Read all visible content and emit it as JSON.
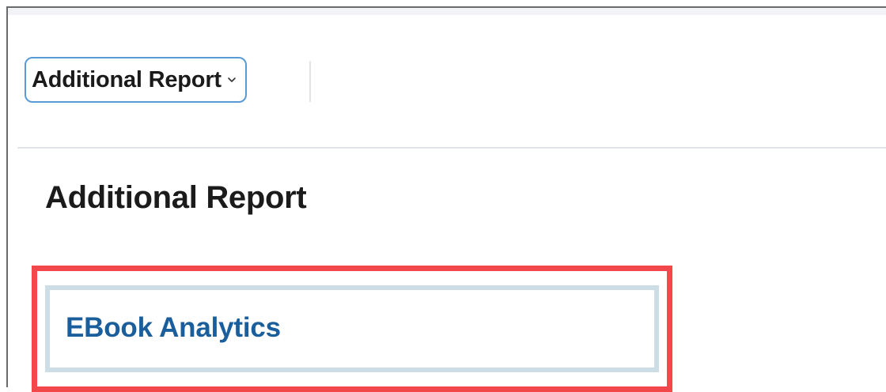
{
  "toolbar": {
    "report_select": {
      "selected": "Additional Report",
      "icon": "chevron-down-icon"
    }
  },
  "page": {
    "title": "Additional Report"
  },
  "reports": [
    {
      "label": "EBook Analytics"
    }
  ],
  "colors": {
    "select_border": "#5b9bd5",
    "link": "#1b5e9c",
    "highlight": "#f2474b",
    "card_border": "#ccdde6"
  }
}
